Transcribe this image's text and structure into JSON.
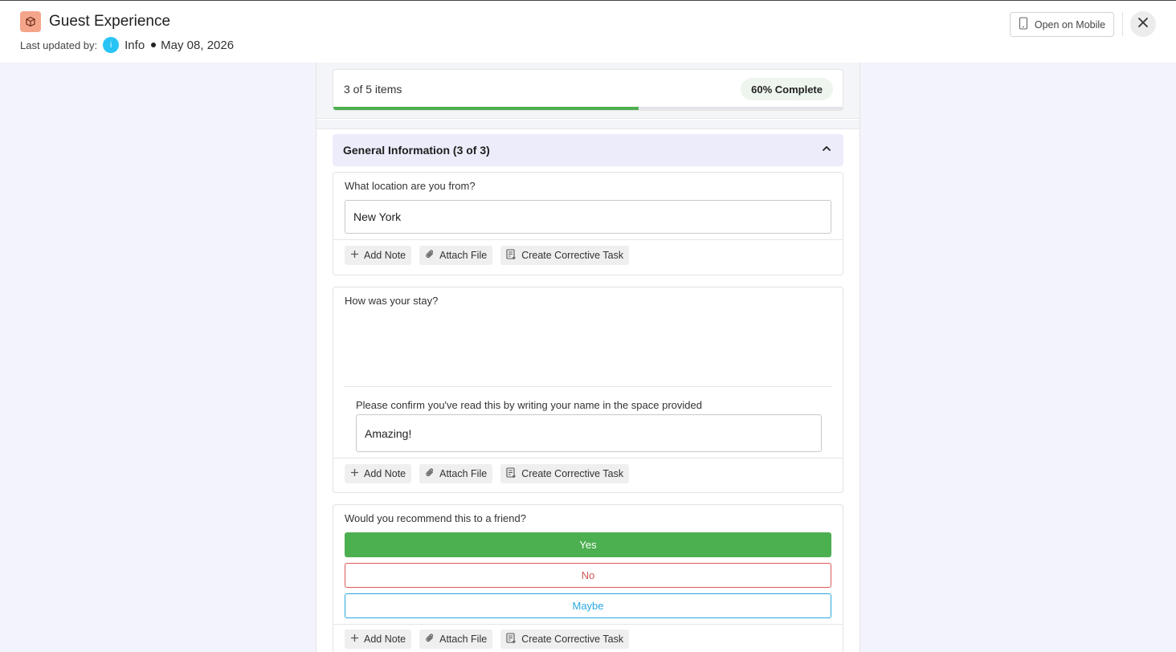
{
  "header": {
    "title": "Guest Experience",
    "last_updated_label": "Last updated by:",
    "user_initial": "i",
    "user_name": "Info",
    "date": "May 08, 2026",
    "open_mobile_label": "Open on Mobile",
    "icons": {
      "app": "box-icon",
      "mobile": "phone-icon",
      "close": "close-icon"
    },
    "colors": {
      "app_icon_bg": "#f4a58a",
      "avatar_bg": "#29c4f5"
    }
  },
  "progress": {
    "items_text": "3 of 5 items",
    "badge": "60% Complete",
    "fraction": 0.6,
    "bar_color": "#4caf50"
  },
  "section": {
    "title": "General Information (3 of 3)",
    "toggle_icon": "chevron-up-icon",
    "bg_color": "#ececfb"
  },
  "actions": {
    "add_note": "Add Note",
    "attach_file": "Attach File",
    "corrective_task": "Create Corrective Task"
  },
  "questions": [
    {
      "label": "What location are you from?",
      "value": "New York"
    },
    {
      "label": "How was your stay?",
      "sub_label": "Please confirm you've read this by writing your name in the space provided",
      "value": "Amazing!"
    },
    {
      "label": "Would you recommend this to a friend?",
      "options": [
        "Yes",
        "No",
        "Maybe"
      ],
      "selected": "Yes"
    }
  ],
  "option_colors": {
    "yes": "#4caf50",
    "no": "#e05a5a",
    "maybe": "#29a8e0"
  }
}
